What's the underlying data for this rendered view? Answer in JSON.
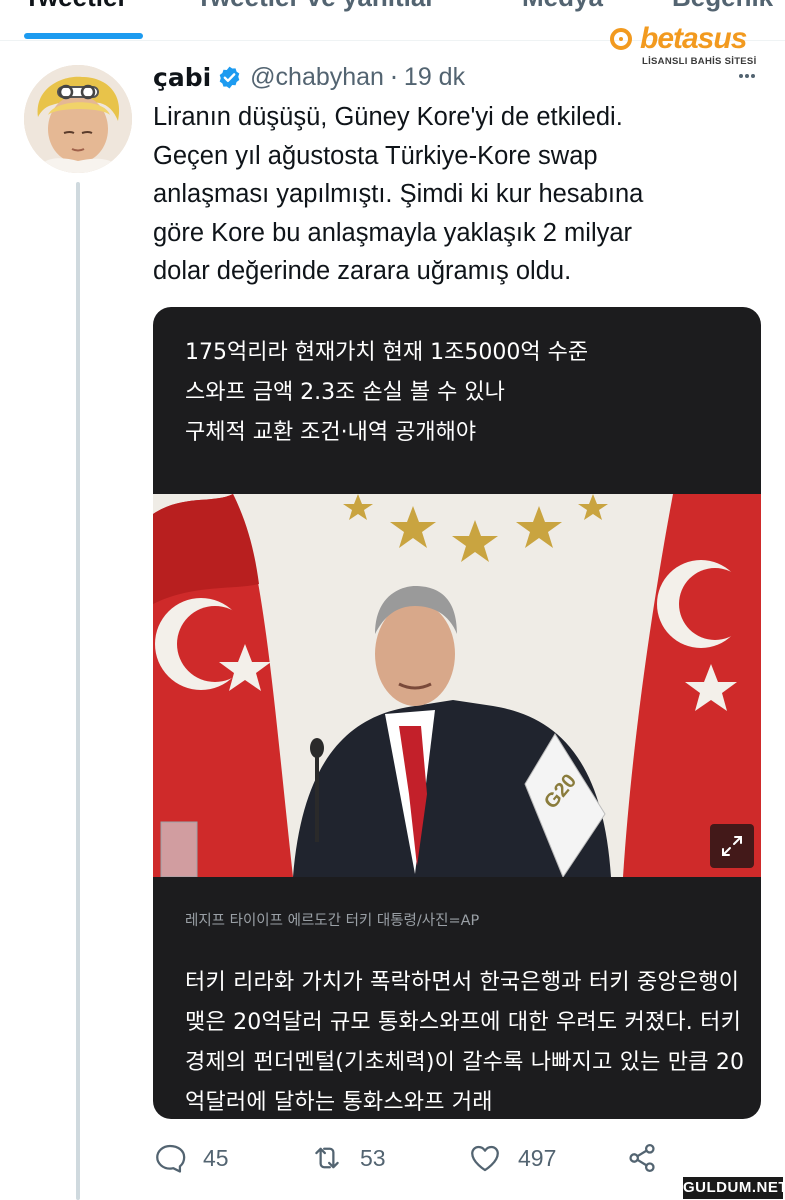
{
  "tabs": [
    {
      "label": "Tweetler"
    },
    {
      "label": "Tweetler ve yanıtlar"
    },
    {
      "label": "Medya"
    },
    {
      "label": "Beğenik"
    }
  ],
  "brand": {
    "name": "betasus",
    "tagline": "LİSANSLI BAHİS SİTESİ"
  },
  "tweet": {
    "author_name": "çabi",
    "handle": "@chabyhan",
    "separator": "·",
    "time": "19 dk",
    "text": "Liranın düşüşü, Güney Kore'yi de etkiledi.\nGeçen yıl ağustosta Türkiye-Kore swap\nanlaşması yapılmıştı. Şimdi ki kur hesabına\ngöre Kore bu anlaşmayla yaklaşık 2 milyar\ndolar değerinde zarara uğramış oldu.",
    "media": {
      "headline": "175억리라 현재가치 현재 1조5000억 수준\n스와프 금액 2.3조 손실 볼 수 있나\n구체적 교환 조건·내역 공개해야",
      "caption": "레지프 타이이프 에르도간 터키 대통령/사진=AP",
      "body": "터키 리라화 가치가 폭락하면서 한국은행과 터키 중앙은행이 맺은 20억달러 규모 통화스와프에 대한 우려도 커졌다. 터키 경제의 펀더멘털(기초체력)이 갈수록 나빠지고 있는 만큼 20억달러에 달하는 통화스와프 거래"
    },
    "stats": {
      "replies": "45",
      "retweets": "53",
      "likes": "497"
    }
  },
  "watermark": "GULDUM.NET",
  "colors": {
    "accent": "#1d9bf0",
    "brand": "#f29a1f",
    "muted": "#536471",
    "card_bg": "#1c1c1e"
  },
  "icons": [
    "verified-badge-icon",
    "more-options-icon",
    "expand-icon",
    "reply-icon",
    "retweet-icon",
    "like-icon",
    "share-icon"
  ]
}
